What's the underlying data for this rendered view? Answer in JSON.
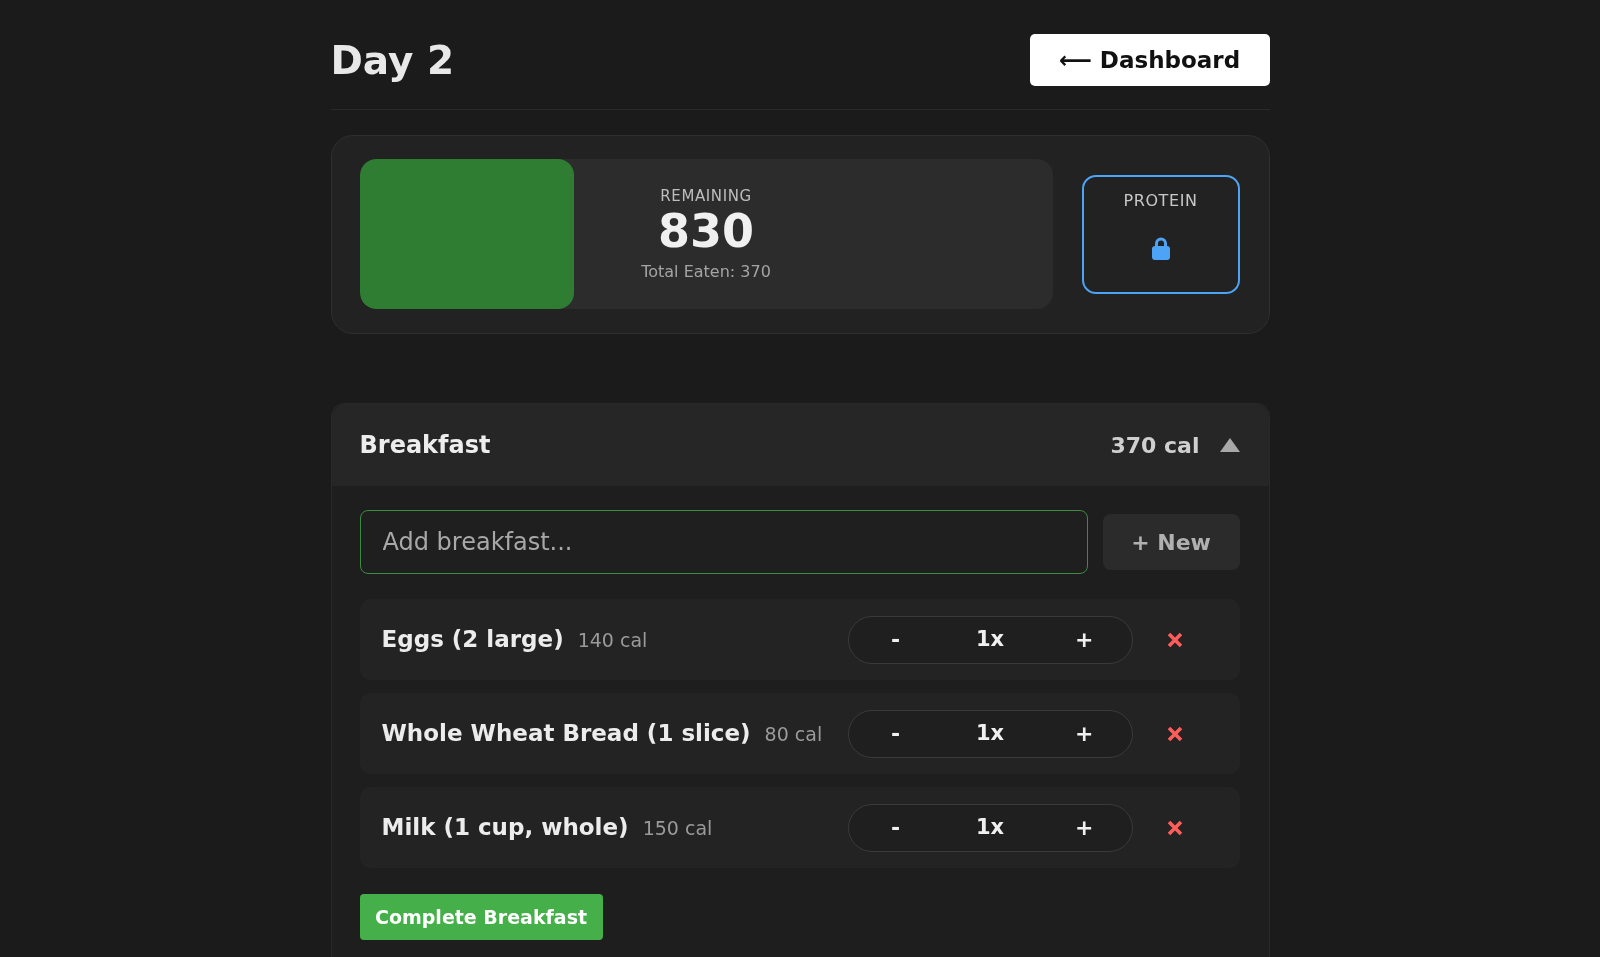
{
  "page": {
    "title": "Day 2",
    "back_button": "⟵ Dashboard"
  },
  "summary": {
    "calories": {
      "label": "REMAINING",
      "value": "830",
      "eaten": "Total Eaten: 370",
      "level": 0.31
    },
    "protein": {
      "label": "PROTEIN",
      "locked": true
    }
  },
  "meals": [
    {
      "name": "Breakfast",
      "total": "370 cal",
      "expanded": true,
      "input": {
        "placeholder": "Add breakfast..."
      },
      "new_button": "+ New",
      "items": [
        {
          "name": "Eggs (2 large)",
          "calories": "140 cal",
          "minus": "-",
          "quantity": "1x",
          "plus": "+"
        },
        {
          "name": "Whole Wheat Bread (1 slice)",
          "calories": "80 cal",
          "minus": "-",
          "quantity": "1x",
          "plus": "+"
        },
        {
          "name": "Milk (1 cup, whole)",
          "calories": "150 cal",
          "minus": "-",
          "quantity": "1x",
          "plus": "+"
        }
      ],
      "complete_button": "Complete Breakfast"
    }
  ]
}
